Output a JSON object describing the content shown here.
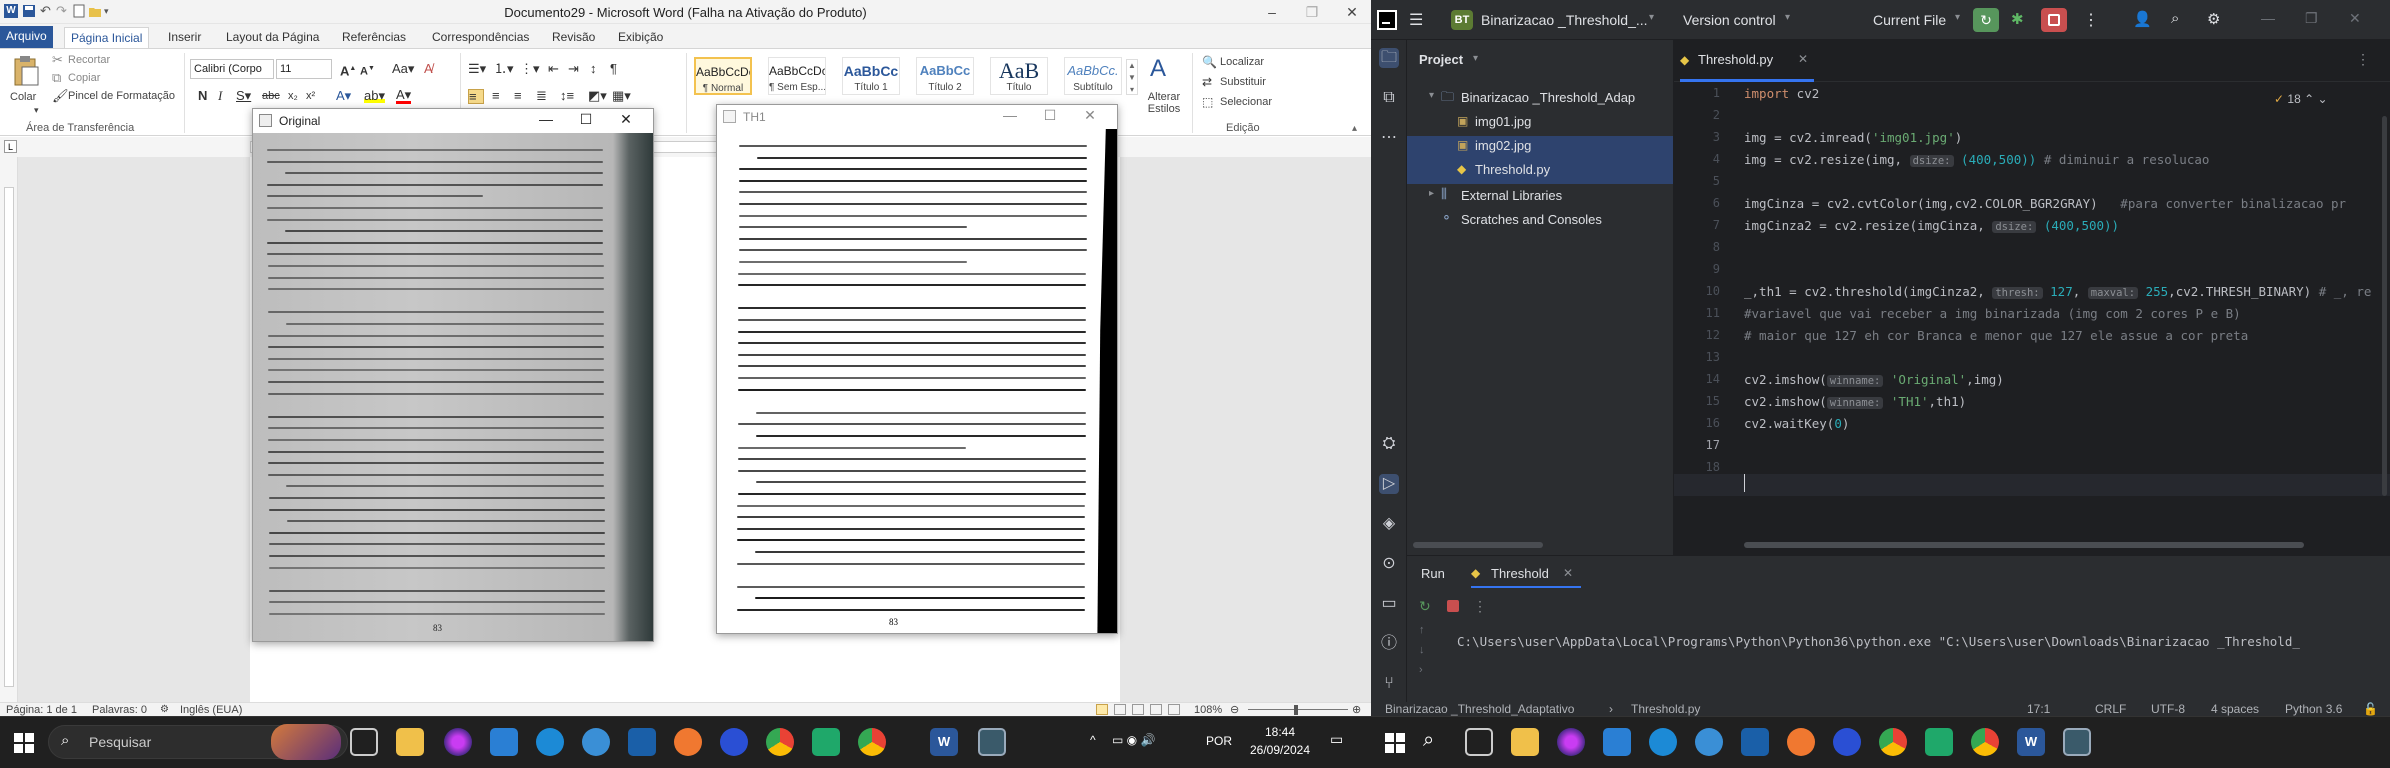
{
  "word": {
    "title": "Documento29 - Microsoft Word (Falha na Ativação do Produto)",
    "tabs": [
      "Arquivo",
      "Página Inicial",
      "Inserir",
      "Layout da Página",
      "Referências",
      "Correspondências",
      "Revisão",
      "Exibição"
    ],
    "clipboard": {
      "paste": "Colar",
      "cut": "Recortar",
      "copy": "Copiar",
      "format_painter": "Pincel de Formatação",
      "group": "Área de Transferência"
    },
    "font": {
      "name": "Calibri (Corpo",
      "size": "11"
    },
    "styles": [
      {
        "preview": "AaBbCcDc",
        "label": "¶ Normal"
      },
      {
        "preview": "AaBbCcDc",
        "label": "¶ Sem Esp..."
      },
      {
        "preview": "AaBbCc",
        "label": "Título 1"
      },
      {
        "preview": "AaBbCc",
        "label": "Título 2"
      },
      {
        "preview": "AaB",
        "label": "Título"
      },
      {
        "preview": "AaBbCc.",
        "label": "Subtítulo"
      }
    ],
    "change_styles": "Alterar Estilos",
    "editing": {
      "find": "Localizar",
      "replace": "Substituir",
      "select": "Selecionar",
      "group": "Edição"
    },
    "status": {
      "page": "Página: 1 de 1",
      "words": "Palavras: 0",
      "lang": "Inglês (EUA)",
      "zoom": "108%"
    }
  },
  "windows": {
    "original": {
      "title": "Original",
      "page_number": "83"
    },
    "th1": {
      "title": "TH1",
      "page_number": "83"
    }
  },
  "pycharm": {
    "project_badge": "BT",
    "project_name": "Binarizacao _Threshold_...",
    "vcs": "Version control",
    "run_config": "Current File",
    "panel_title": "Project",
    "tree": [
      {
        "label": "Binarizacao _Threshold_Adap"
      },
      {
        "label": "img01.jpg"
      },
      {
        "label": "img02.jpg"
      },
      {
        "label": "Threshold.py"
      },
      {
        "label": "External Libraries"
      },
      {
        "label": "Scratches and Consoles"
      }
    ],
    "editor_tab": "Threshold.py",
    "warning_count": "18",
    "line_numbers": [
      "1",
      "2",
      "3",
      "4",
      "5",
      "6",
      "7",
      "8",
      "9",
      "10",
      "11",
      "12",
      "13",
      "14",
      "15",
      "16",
      "17",
      "18"
    ],
    "code": {
      "l1_kw": "import",
      "l1_rest": " cv2",
      "l3_a": "img = cv2.imread(",
      "l3_s": "'img01.jpg'",
      "l3_b": ")",
      "l4_a": "img = cv2.resize(img, ",
      "l4_h": "dsize:",
      "l4_n": " (400,500))",
      "l4_c": " # diminuir a resolucao",
      "l6_a": "imgCinza = cv2.cvtColor(img,cv2.COLOR_BGR2GRAY)",
      "l6_c": "   #para converter binalizacao pr",
      "l7_a": "imgCinza2 = cv2.resize(imgCinza, ",
      "l7_h": "dsize:",
      "l7_n": " (400,500))",
      "l10_a": "_,th1 = cv2.threshold(imgCinza2, ",
      "l10_h1": "thresh:",
      "l10_n1": " 127",
      "l10_p": ", ",
      "l10_h2": "maxval:",
      "l10_n2": " 255",
      "l10_b": ",cv2.THRESH_BINARY)",
      "l10_c": " # _, re",
      "l11_c": "#variavel que vai receber a img binarizada (img com 2 cores P e B)",
      "l12_c": "# maior que 127 eh cor Branca e menor que 127 ele assue a cor preta",
      "l14_a": "cv2.imshow(",
      "l14_h": "winname:",
      "l14_s": " 'Original'",
      "l14_b": ",img)",
      "l15_a": "cv2.imshow(",
      "l15_h": "winname:",
      "l15_s": " 'TH1'",
      "l15_b": ",th1)",
      "l16_a": "cv2.waitKey(",
      "l16_n": "0",
      "l16_b": ")"
    },
    "run_tab": "Run",
    "run_config_tab": "Threshold",
    "console": "C:\\Users\\user\\AppData\\Local\\Programs\\Python\\Python36\\python.exe \"C:\\Users\\user\\Downloads\\Binarizacao _Threshold_",
    "status": {
      "breadcrumb_project": "Binarizacao _Threshold_Adaptativo",
      "breadcrumb_file": "Threshold.py",
      "position": "17:1",
      "eol": "CRLF",
      "encoding": "UTF-8",
      "indent": "4 spaces",
      "interpreter": "Python 3.6"
    }
  },
  "taskbar": {
    "search": "Pesquisar",
    "lang": "POR",
    "time": "18:44",
    "date": "26/09/2024"
  },
  "colors": {
    "word_blue": "#2b579a",
    "pycharm_bg": "#1e1f22",
    "taskbar": "#202020"
  }
}
